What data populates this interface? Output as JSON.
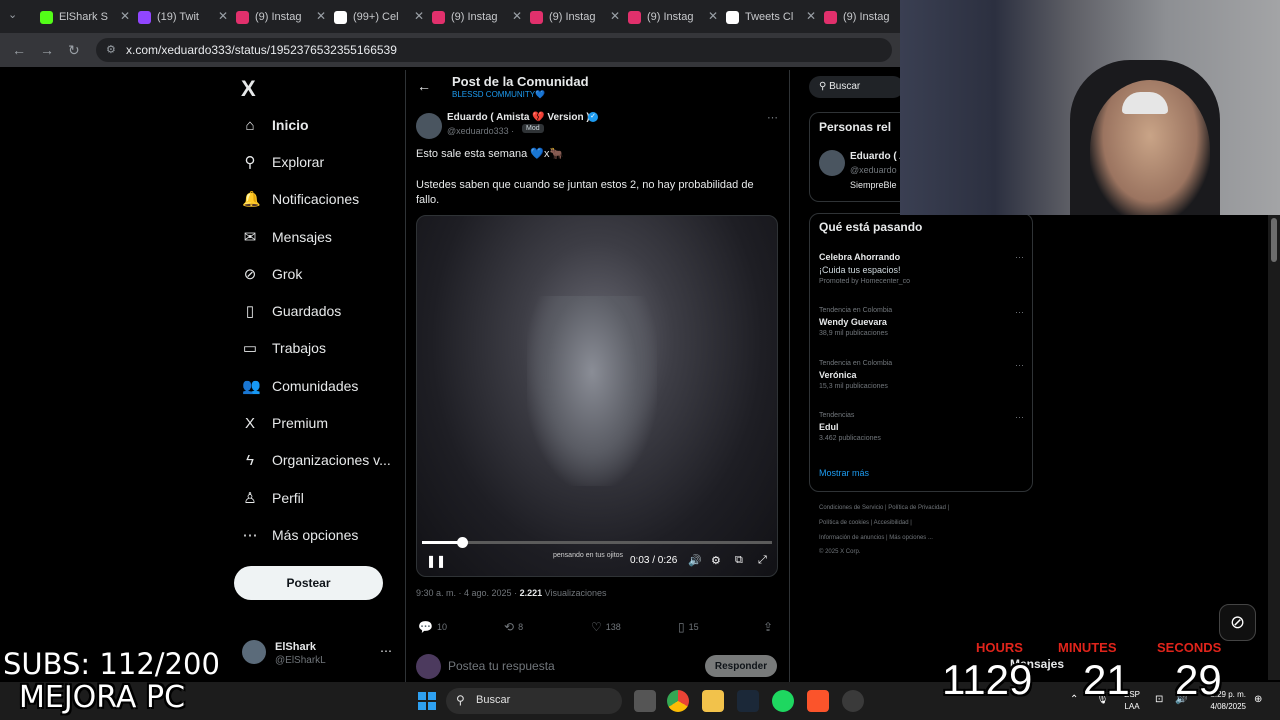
{
  "browser": {
    "tabs": [
      {
        "label": "ElShark S",
        "color": "#53fc18"
      },
      {
        "label": "(19) Twit",
        "color": "#9146ff"
      },
      {
        "label": "(9) Instag",
        "color": "#e1306c"
      },
      {
        "label": "(99+) Cel",
        "color": "#ffffff"
      },
      {
        "label": "(9) Instag",
        "color": "#e1306c"
      },
      {
        "label": "(9) Instag",
        "color": "#e1306c"
      },
      {
        "label": "(9) Instag",
        "color": "#e1306c"
      },
      {
        "label": "Tweets Cl",
        "color": "#ffffff"
      },
      {
        "label": "(9) Instag",
        "color": "#e1306c"
      }
    ],
    "url": "x.com/xeduardo333/status/1952376532355166539"
  },
  "nav": {
    "logo": "X",
    "items": [
      {
        "label": "Inicio",
        "icon": "home-icon",
        "glyph": "⌂"
      },
      {
        "label": "Explorar",
        "icon": "search-icon",
        "glyph": "⚲"
      },
      {
        "label": "Notificaciones",
        "icon": "bell-icon",
        "glyph": "🔔"
      },
      {
        "label": "Mensajes",
        "icon": "mail-icon",
        "glyph": "✉"
      },
      {
        "label": "Grok",
        "icon": "grok-icon",
        "glyph": "⊘"
      },
      {
        "label": "Guardados",
        "icon": "bookmark-icon",
        "glyph": "▯"
      },
      {
        "label": "Trabajos",
        "icon": "briefcase-icon",
        "glyph": "▭"
      },
      {
        "label": "Comunidades",
        "icon": "people-icon",
        "glyph": "👥"
      },
      {
        "label": "Premium",
        "icon": "x-icon",
        "glyph": "X"
      },
      {
        "label": "Organizaciones v...",
        "icon": "lightning-icon",
        "glyph": "ϟ"
      },
      {
        "label": "Perfil",
        "icon": "person-icon",
        "glyph": "♙"
      },
      {
        "label": "Más opciones",
        "icon": "more-icon",
        "glyph": "⋯"
      }
    ],
    "post_button": "Postear",
    "account": {
      "name": "ElShark",
      "handle": "@ElSharkL"
    }
  },
  "post": {
    "header_title": "Post de la Comunidad",
    "header_sub": "BLESSD COMMUNITY💙",
    "author_name": "Eduardo ( Amista 💔 Version )",
    "author_handle": "@xeduardo333 ·",
    "badge": "Mod",
    "text1": "Esto sale esta semana 💙x🐂",
    "text2": "Ustedes saben que cuando se juntan estos 2, no hay probabilidad de fallo.",
    "video": {
      "caption": "pensando en tus ojitos",
      "time": "0:03 / 0:26",
      "progress": 0.115
    },
    "meta_time": "9:30 a. m. · 4 ago. 2025 ·",
    "views": "2.221",
    "views_label": "Visualizaciones",
    "stats": {
      "replies": "10",
      "reposts": "8",
      "likes": "138",
      "bookmarks": "15"
    },
    "reply_placeholder": "Postea tu respuesta",
    "reply_button": "Responder"
  },
  "sidebar": {
    "search_placeholder": "Buscar",
    "people_title": "Personas rel",
    "person": {
      "name": "Eduardo ( A",
      "handle": "@xeduardo",
      "bio": "SiempreBle"
    },
    "trends_title": "Qué está pasando",
    "trends": [
      {
        "context": "",
        "name": "Celebra Ahorrando",
        "count": "¡Cuida tus espacios!",
        "promo": "Promoted by Homecenter_co"
      },
      {
        "context": "Tendencia en Colombia",
        "name": "Wendy Guevara",
        "count": "38,9 mil publicaciones",
        "promo": ""
      },
      {
        "context": "Tendencia en Colombia",
        "name": "Verónica",
        "count": "15,3 mil publicaciones",
        "promo": ""
      },
      {
        "context": "Tendencias",
        "name": "Edul",
        "count": "3.462 publicaciones",
        "promo": ""
      }
    ],
    "show_more": "Mostrar más",
    "footer": [
      "Condiciones de Servicio  |  Política de Privacidad  |",
      "Política de cookies  |  Accesibilidad  |",
      "Información de anuncios  |  Más opciones ...",
      "© 2025 X Corp."
    ]
  },
  "overlay": {
    "subs": "SUBS: 112/200",
    "mejora": "MEJORA PC",
    "timer": {
      "hours_label": "HOURS",
      "hours": "1129",
      "minutes_label": "MINUTES",
      "minutes": "21",
      "seconds_label": "SECONDS",
      "seconds": "29"
    },
    "mensajes": "Mensajes"
  },
  "taskbar": {
    "search": "Buscar",
    "lang": "ESP\nLAA",
    "time": "2:29 p. m.",
    "date": "4/08/2025"
  }
}
